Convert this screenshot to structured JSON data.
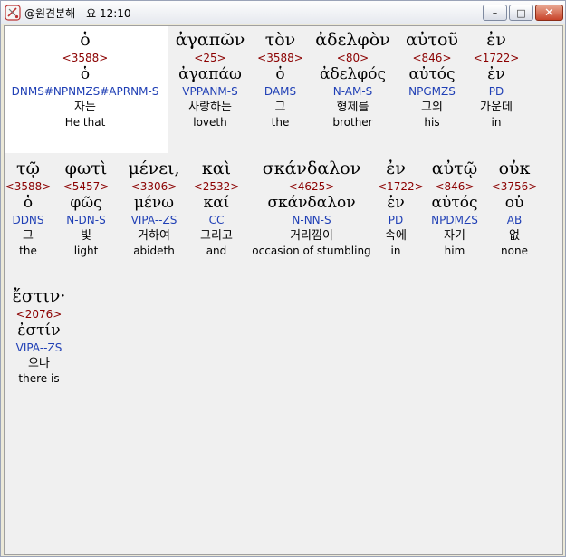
{
  "window": {
    "title": "@원견분해 - 요 12:10",
    "minimize_label": "–",
    "maximize_label": "□",
    "close_label": "✕"
  },
  "rows": [
    [
      {
        "greek": "ὁ",
        "strong": "<3588>",
        "lemma": "ὁ",
        "parse": "DNMS#NPNMZS#APRNM-S",
        "korean": "자는",
        "english": "He that"
      },
      {
        "greek": "ἀγαπῶν",
        "strong": "<25>",
        "lemma": "ἀγαπάω",
        "parse": "VPPANM-S",
        "korean": "사랑하는",
        "english": "loveth"
      },
      {
        "greek": "τὸν",
        "strong": "<3588>",
        "lemma": "ὁ",
        "parse": "DAMS",
        "korean": "그",
        "english": "the"
      },
      {
        "greek": "ἀδελφὸν",
        "strong": "<80>",
        "lemma": "ἀδελφός",
        "parse": "N-AM-S",
        "korean": "형제를",
        "english": "brother"
      },
      {
        "greek": "αὐτοῦ",
        "strong": "<846>",
        "lemma": "αὐτός",
        "parse": "NPGMZS",
        "korean": "그의",
        "english": "his"
      },
      {
        "greek": "ἐν",
        "strong": "<1722>",
        "lemma": "ἐν",
        "parse": "PD",
        "korean": "가운데",
        "english": "in"
      }
    ],
    [
      {
        "greek": "τῷ",
        "strong": "<3588>",
        "lemma": "ὁ",
        "parse": "DDNS",
        "korean": "그",
        "english": "the"
      },
      {
        "greek": "φωτὶ",
        "strong": "<5457>",
        "lemma": "φῶς",
        "parse": "N-DN-S",
        "korean": "빛",
        "english": "light"
      },
      {
        "greek": "μένει,",
        "strong": "<3306>",
        "lemma": "μένω",
        "parse": "VIPA--ZS",
        "korean": "거하여",
        "english": "abideth"
      },
      {
        "greek": "καὶ",
        "strong": "<2532>",
        "lemma": "καί",
        "parse": "CC",
        "korean": "그리고",
        "english": "and"
      },
      {
        "greek": "σκάνδαλον",
        "strong": "<4625>",
        "lemma": "σκάνδαλον",
        "parse": "N-NN-S",
        "korean": "거리낌이",
        "english": "occasion of stumbling"
      },
      {
        "greek": "ἐν",
        "strong": "<1722>",
        "lemma": "ἐν",
        "parse": "PD",
        "korean": "속에",
        "english": "in"
      },
      {
        "greek": "αὐτῷ",
        "strong": "<846>",
        "lemma": "αὐτός",
        "parse": "NPDMZS",
        "korean": "자기",
        "english": "him"
      },
      {
        "greek": "οὐκ",
        "strong": "<3756>",
        "lemma": "οὐ",
        "parse": "AB",
        "korean": "없",
        "english": "none"
      }
    ],
    [
      {
        "greek": "ἔστιν·",
        "strong": "<2076>",
        "lemma": "ἐστίν",
        "parse": "VIPA--ZS",
        "korean": "으나",
        "english": "there is"
      }
    ]
  ],
  "colors": {
    "strong_number": "#8b0000",
    "parsing_code": "#1f3fb5",
    "selected_background": "#ffffff",
    "panel_background": "#f0f0f0"
  },
  "icons": {
    "app": "app-icon",
    "minimize": "minimize-icon",
    "maximize": "maximize-icon",
    "close": "close-icon"
  }
}
